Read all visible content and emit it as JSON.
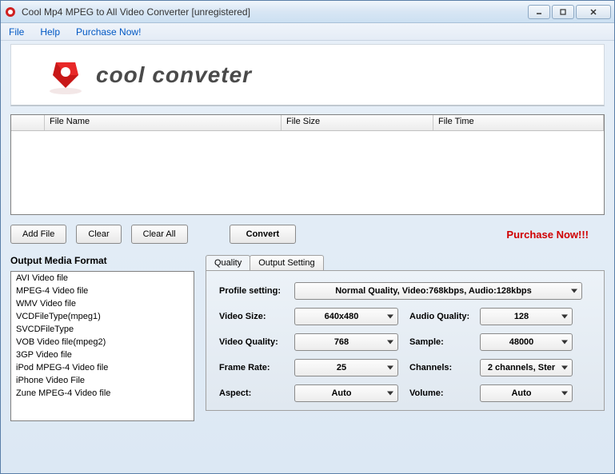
{
  "window": {
    "title": "Cool Mp4 MPEG to All Video Converter  [unregistered]"
  },
  "menu": {
    "file": "File",
    "help": "Help",
    "purchase": "Purchase Now!"
  },
  "logo": {
    "text": "cool conveter"
  },
  "table": {
    "col_name": "File Name",
    "col_size": "File Size",
    "col_time": "File Time"
  },
  "buttons": {
    "add": "Add File",
    "clear": "Clear",
    "clear_all": "Clear All",
    "convert": "Convert"
  },
  "purchase_now": "Purchase Now!!!",
  "format": {
    "title": "Output Media Format",
    "items": [
      "AVI Video file",
      "MPEG-4 Video file",
      "WMV Video file",
      "VCDFileType(mpeg1)",
      "SVCDFileType",
      "VOB Video file(mpeg2)",
      "3GP Video file",
      "iPod MPEG-4 Video file",
      "iPhone Video File",
      "Zune MPEG-4 Video file"
    ]
  },
  "tabs": {
    "quality": "Quality",
    "output": "Output Setting"
  },
  "settings": {
    "profile_label": "Profile setting:",
    "profile_value": "Normal Quality, Video:768kbps, Audio:128kbps",
    "video_size_label": "Video Size:",
    "video_size_value": "640x480",
    "audio_quality_label": "Audio Quality:",
    "audio_quality_value": "128",
    "video_quality_label": "Video Quality:",
    "video_quality_value": "768",
    "sample_label": "Sample:",
    "sample_value": "48000",
    "frame_rate_label": "Frame Rate:",
    "frame_rate_value": "25",
    "channels_label": "Channels:",
    "channels_value": "2 channels, Ster",
    "aspect_label": "Aspect:",
    "aspect_value": "Auto",
    "volume_label": "Volume:",
    "volume_value": "Auto"
  }
}
